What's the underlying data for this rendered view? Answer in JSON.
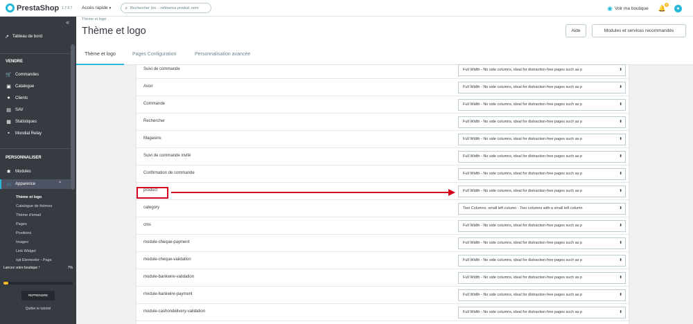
{
  "topbar": {
    "logo": "PrestaShop",
    "version": "1.7.6.7",
    "quick_access": "Accès rapide",
    "search_placeholder": "Rechercher (ex. : référence produit, nom",
    "view_shop": "Voir ma boutique",
    "notif_count": "5"
  },
  "sidebar": {
    "dashboard": "Tableau de bord",
    "section_sell": "VENDRE",
    "sell_items": [
      {
        "label": "Commandes",
        "icon": "cart-icon"
      },
      {
        "label": "Catalogue",
        "icon": "store-icon"
      },
      {
        "label": "Clients",
        "icon": "account-icon"
      },
      {
        "label": "SAV",
        "icon": "chat-icon"
      },
      {
        "label": "Statistiques",
        "icon": "chart-icon"
      },
      {
        "label": "Mondial Relay",
        "icon": "truck-icon"
      }
    ],
    "section_custom": "PERSONNALISER",
    "modules": "Modules",
    "appearance": "Apparence",
    "submenu": [
      "Thème et logo",
      "Catalogue de thèmes",
      "Thème d'email",
      "Pages",
      "Positions",
      "Images",
      "Link Widget",
      "Iqit Elementor - Page"
    ]
  },
  "onboarding": {
    "title": "Lancez votre boutique !",
    "percent": "7%",
    "progress": 0.07,
    "button": "REPRENDRE",
    "quit": "Quitter le tutoriel"
  },
  "header": {
    "breadcrumb": "Thème et logo",
    "title": "Thème et logo",
    "help_button": "Aide",
    "modules_button": "Modules et services recommandés"
  },
  "tabs": [
    "Thème et logo",
    "Pages Configuration",
    "Personnalisation avancée"
  ],
  "layout_rows": [
    {
      "page": "Suivi de commande",
      "layout": "Full Width - No side columns, ideal for distraction-free pages such as p"
    },
    {
      "page": "Avoir",
      "layout": "Full Width - No side columns, ideal for distraction-free pages such as p"
    },
    {
      "page": "Commande",
      "layout": "Full Width - No side columns, ideal for distraction-free pages such as p"
    },
    {
      "page": "Rechercher",
      "layout": "Full Width - No side columns, ideal for distraction-free pages such as p"
    },
    {
      "page": "Magasins",
      "layout": "Full Width - No side columns, ideal for distraction-free pages such as p"
    },
    {
      "page": "Suivi de commande invité",
      "layout": "Full Width - No side columns, ideal for distraction-free pages such as p"
    },
    {
      "page": "Confirmation de commande",
      "layout": "Full Width - No side columns, ideal for distraction-free pages such as p"
    },
    {
      "page": "product",
      "layout": "Full Width - No side columns, ideal for distraction-free pages such as p"
    },
    {
      "page": "category",
      "layout": "Two Columns, small left column - Two columns with a small left column"
    },
    {
      "page": "cms",
      "layout": "Full Width - No side columns, ideal for distraction-free pages such as p"
    },
    {
      "page": "module-cheque-payment",
      "layout": "Full Width - No side columns, ideal for distraction-free pages such as p"
    },
    {
      "page": "module-cheque-validation",
      "layout": "Full Width - No side columns, ideal for distraction-free pages such as p"
    },
    {
      "page": "module-bankwire-validation",
      "layout": "Full Width - No side columns, ideal for distraction-free pages such as p"
    },
    {
      "page": "module-bankwire-payment",
      "layout": "Full Width - No side columns, ideal for distraction-free pages such as p"
    },
    {
      "page": "module-cashondelivery-validation",
      "layout": "Full Width - No side columns, ideal for distraction-free pages such as p"
    }
  ],
  "colors": {
    "accent": "#25b9d7",
    "sidebar": "#363a41",
    "annotation": "#d6001c"
  }
}
